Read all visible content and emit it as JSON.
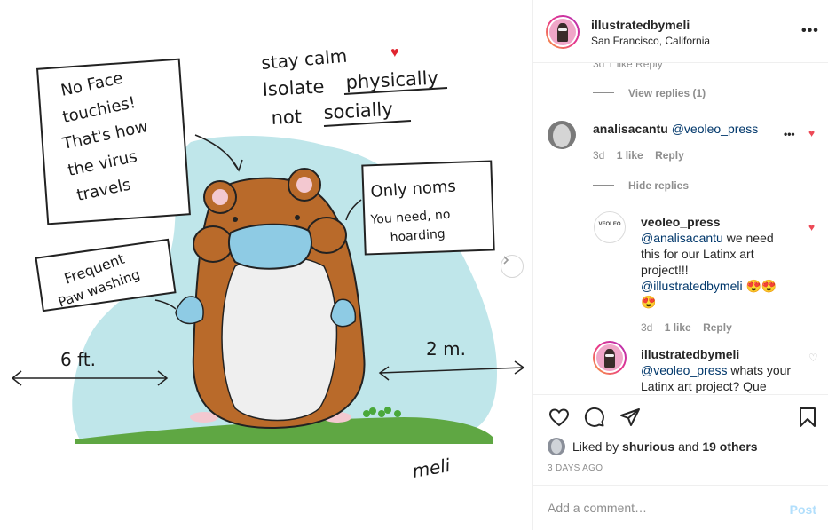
{
  "post": {
    "username": "illustratedbymeli",
    "location": "San Francisco, California",
    "more_label": "•••"
  },
  "illustration": {
    "note_face": [
      "No Face",
      "touchies!",
      "That's how",
      "the virus",
      "travels"
    ],
    "stay_calm": "stay calm",
    "isolate_line": [
      "Isolate",
      "physically"
    ],
    "not_line": [
      "not",
      "socially"
    ],
    "noms": [
      "Only noms",
      "You need, no",
      "hoarding"
    ],
    "paw": [
      "Frequent",
      "Paw washing"
    ],
    "six_ft": "6 ft.",
    "two_m": "2 m.",
    "signature": "meli"
  },
  "comments": {
    "top_partial_meta": "3d   1 like   Reply",
    "view_replies": "View replies (1)",
    "c1": {
      "username": "analisacantu",
      "mention": "@veoleo_press",
      "time": "3d",
      "likes": "1 like",
      "reply": "Reply",
      "more": "•••"
    },
    "hide_replies": "Hide replies",
    "r1": {
      "username": "veoleo_press",
      "avatar_text": "VEOLEO",
      "mention1": "@analisacantu",
      "text1": " we need",
      "text2": "this for our Latinx art",
      "text3": "project!!!",
      "mention2": "@illustratedbymeli",
      "emoji": "😍😍",
      "emoji2": "😍",
      "time": "3d",
      "likes": "1 like",
      "reply": "Reply"
    },
    "r2": {
      "username": "illustratedbymeli",
      "mention": "@veoleo_press",
      "text1": " whats your",
      "text2": "Latinx art project? Que"
    }
  },
  "actions": {
    "liked_prefix": "Liked by ",
    "liked_user": "shurious",
    "liked_and": " and ",
    "liked_others": "19 others",
    "days_ago": "3 DAYS AGO"
  },
  "composer": {
    "placeholder": "Add a comment…",
    "post_label": "Post"
  },
  "colors": {
    "hamster_body": "#b96a2a",
    "hamster_belly": "#efefef",
    "mask": "#8ecbe4",
    "sky": "#bfe6ea",
    "grass": "#5fa743",
    "like_red": "#ed4956",
    "post_disabled": "#b2dffc"
  }
}
